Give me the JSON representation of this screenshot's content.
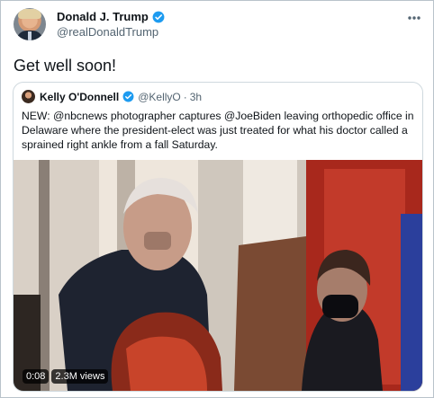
{
  "tweet": {
    "author_name": "Donald J. Trump",
    "author_handle": "@realDonaldTrump",
    "text": "Get well soon!",
    "more_icon": "more-icon"
  },
  "quote": {
    "author_name": "Kelly O'Donnell",
    "author_handle": "@KellyO",
    "separator": "·",
    "time": "3h",
    "text": "NEW:  @nbcnews photographer captures @JoeBiden leaving orthopedic office in Delaware where the president-elect was just treated for what his doctor called a sprained right ankle from a fall Saturday."
  },
  "video": {
    "duration": "0:08",
    "views": "2.3M views"
  },
  "colors": {
    "verified": "#1d9bf0",
    "secondary_text": "#536471",
    "border": "#cfd9de"
  }
}
